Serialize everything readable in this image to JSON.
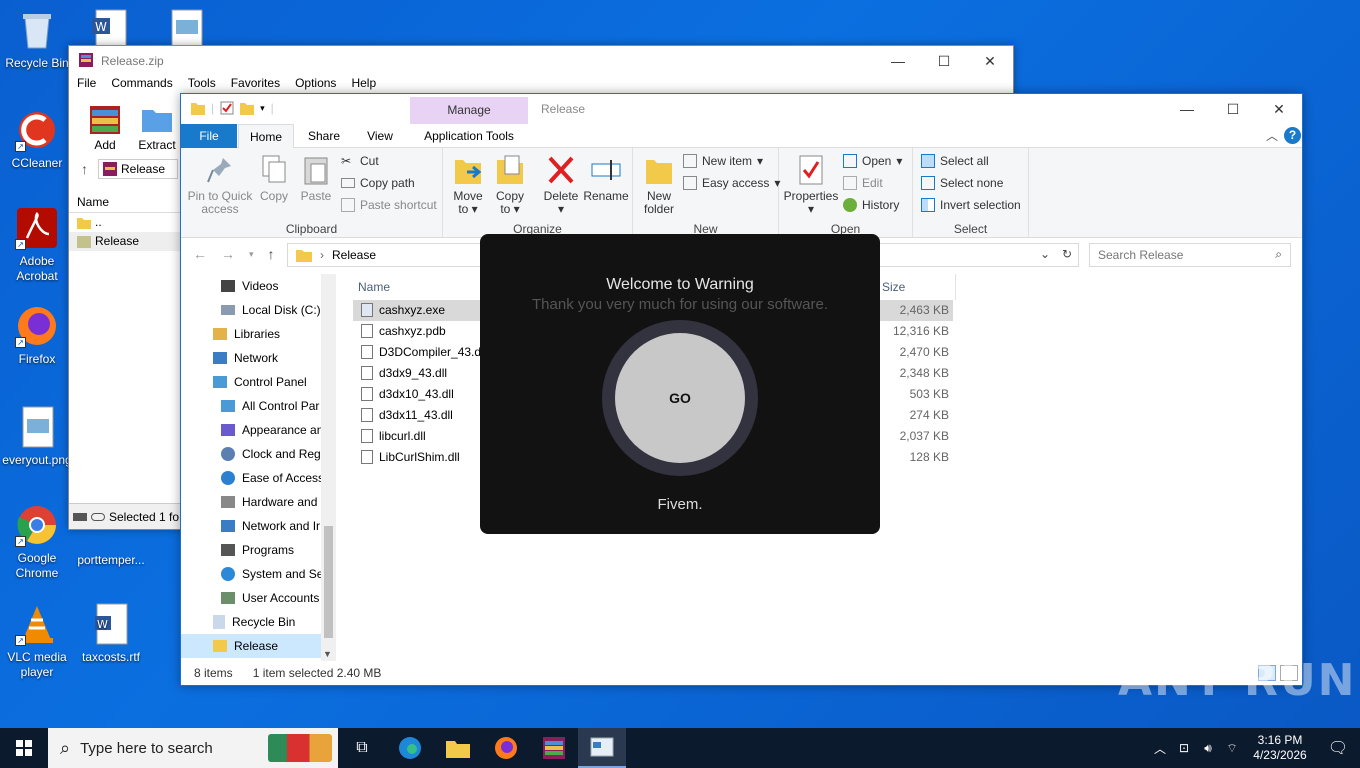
{
  "desktop": {
    "icons": [
      {
        "label": "Recycle Bin"
      },
      {
        "label": "CCleaner"
      },
      {
        "label": "Adobe Acrobat"
      },
      {
        "label": "Firefox"
      },
      {
        "label": "everyout.png"
      },
      {
        "label": "Google Chrome"
      },
      {
        "label": "porttemper..."
      },
      {
        "label": "VLC media player"
      },
      {
        "label": "taxcosts.rtf"
      }
    ]
  },
  "winrar": {
    "title": "Release.zip",
    "menu": [
      "File",
      "Commands",
      "Tools",
      "Favorites",
      "Options",
      "Help"
    ],
    "tools": [
      "Add",
      "Extract"
    ],
    "path": "Release",
    "list_header": "Name",
    "rows": [
      "..",
      "Release"
    ],
    "status": "Selected 1 fo"
  },
  "explorer": {
    "manage_label": "Manage",
    "title": "Release",
    "tabs": [
      "File",
      "Home",
      "Share",
      "View",
      "Application Tools"
    ],
    "ribbon": {
      "clipboard": {
        "label": "Clipboard",
        "pin": "Pin to Quick access",
        "copy": "Copy",
        "paste": "Paste",
        "cut": "Cut",
        "copy_path": "Copy path",
        "paste_shortcut": "Paste shortcut"
      },
      "organize": {
        "label": "Organize",
        "move_to": "Move to",
        "copy_to": "Copy to",
        "delete": "Delete",
        "rename": "Rename"
      },
      "new": {
        "label": "New",
        "new_folder": "New folder",
        "new_item": "New item",
        "easy_access": "Easy access"
      },
      "open": {
        "label": "Open",
        "properties": "Properties",
        "open": "Open",
        "edit": "Edit",
        "history": "History"
      },
      "select": {
        "label": "Select",
        "select_all": "Select all",
        "select_none": "Select none",
        "invert": "Invert selection"
      }
    },
    "address": "Release",
    "search_placeholder": "Search Release",
    "nav_items": [
      {
        "label": "Videos"
      },
      {
        "label": "Local Disk (C:)"
      },
      {
        "label": "Libraries"
      },
      {
        "label": "Network"
      },
      {
        "label": "Control Panel"
      },
      {
        "label": "All Control Par"
      },
      {
        "label": "Appearance an"
      },
      {
        "label": "Clock and Regi"
      },
      {
        "label": "Ease of Access"
      },
      {
        "label": "Hardware and"
      },
      {
        "label": "Network and Ir"
      },
      {
        "label": "Programs"
      },
      {
        "label": "System and Sec"
      },
      {
        "label": "User Accounts"
      },
      {
        "label": "Recycle Bin"
      },
      {
        "label": "Release"
      }
    ],
    "columns": {
      "name": "Name",
      "size": "Size"
    },
    "files": [
      {
        "name": "cashxyz.exe",
        "size": "2,463 KB"
      },
      {
        "name": "cashxyz.pdb",
        "size": "12,316 KB"
      },
      {
        "name": "D3DCompiler_43.dll",
        "size": "2,470 KB"
      },
      {
        "name": "d3dx9_43.dll",
        "size": "2,348 KB"
      },
      {
        "name": "d3dx10_43.dll",
        "size": "503 KB"
      },
      {
        "name": "d3dx11_43.dll",
        "size": "274 KB"
      },
      {
        "name": "libcurl.dll",
        "size": "2,037 KB"
      },
      {
        "name": "LibCurlShim.dll",
        "size": "128 KB"
      }
    ],
    "status": {
      "items": "8 items",
      "selected": "1 item selected  2.40 MB"
    }
  },
  "dialog": {
    "title": "Welcome to  Warning",
    "subtitle": "Thank you very much for using our software.",
    "go": "GO",
    "footer": "Fivem."
  },
  "taskbar": {
    "search_placeholder": "Type here to search",
    "time": "3:16 PM",
    "date": "4/23/2026"
  },
  "watermark": "ANY RUN"
}
